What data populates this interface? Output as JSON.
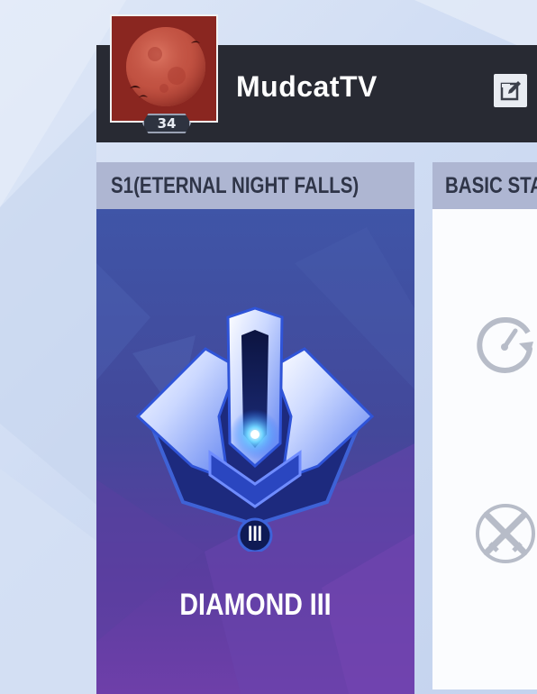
{
  "profile": {
    "username": "MudcatTV",
    "level": "34"
  },
  "season": {
    "title": "S1(ETERNAL NIGHT FALLS)",
    "rank_name": "DIAMOND III",
    "rank_tier": "III"
  },
  "stats": {
    "title": "BASIC STA"
  },
  "icons": {
    "edit": "edit-icon",
    "speed": "speedometer-icon",
    "weapons": "crossed-swords-icon"
  },
  "colors": {
    "header_bg": "#282a33",
    "panel_header": "#aeb6d2",
    "season_bg_top": "#3f55a7",
    "season_bg_bottom": "#6e3fa9"
  }
}
